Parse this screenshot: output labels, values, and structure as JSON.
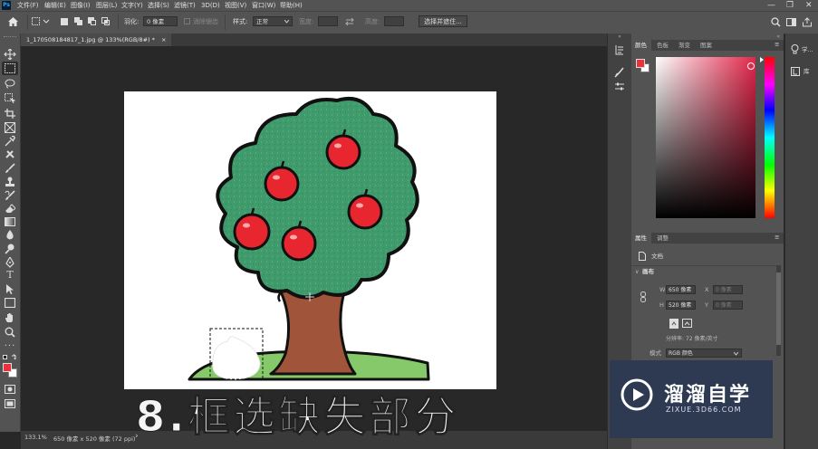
{
  "app": {
    "logo_text": "Ps"
  },
  "menu": [
    {
      "label": "文件(F)"
    },
    {
      "label": "编辑(E)"
    },
    {
      "label": "图像(I)"
    },
    {
      "label": "图层(L)"
    },
    {
      "label": "文字(Y)"
    },
    {
      "label": "选择(S)"
    },
    {
      "label": "滤镜(T)"
    },
    {
      "label": "3D(D)"
    },
    {
      "label": "视图(V)"
    },
    {
      "label": "窗口(W)"
    },
    {
      "label": "帮助(H)"
    }
  ],
  "window_controls": {
    "minimize": "—",
    "restore": "❐",
    "close": "✕"
  },
  "options": {
    "feather_label": "羽化:",
    "feather_value": "0 像素",
    "antialias_label": "消除锯齿",
    "style_label": "样式:",
    "style_value": "正常",
    "width_label": "宽度:",
    "height_label": "高度:",
    "select_mask_button": "选择并遮住..."
  },
  "document": {
    "tab_title": "1_170508184817_1.jpg @ 133%(RGB/8#) *",
    "close_icon": "×"
  },
  "status": {
    "zoom": "133.1%",
    "doc_info": "650 像素 x 520 像素 (72 ppi)",
    "arrow": "›"
  },
  "color_panel": {
    "tabs": [
      "颜色",
      "色板",
      "渐变",
      "图案"
    ],
    "fg_color": "#e8323c",
    "bg_color": "#ffffff",
    "picker_hue": "#e4264a"
  },
  "properties_panel": {
    "tabs": [
      "属性",
      "调整"
    ],
    "doc_label": "文档",
    "section_title": "画布",
    "w_label": "W",
    "w_value": "650 像素",
    "x_label": "X",
    "x_value": "0 像素",
    "h_label": "H",
    "h_value": "520 像素",
    "y_label": "Y",
    "y_value": "0 像素",
    "resolution": "分辨率: 72 像素/英寸",
    "mode_label": "模式",
    "mode_value": "RGB 颜色"
  },
  "far_right": {
    "learn_label": "学...",
    "library_label": "库"
  },
  "watermark": {
    "brand": "溜溜自学",
    "url": "ZIXUE.3D66.COM"
  },
  "caption": "8.框选缺失部分"
}
